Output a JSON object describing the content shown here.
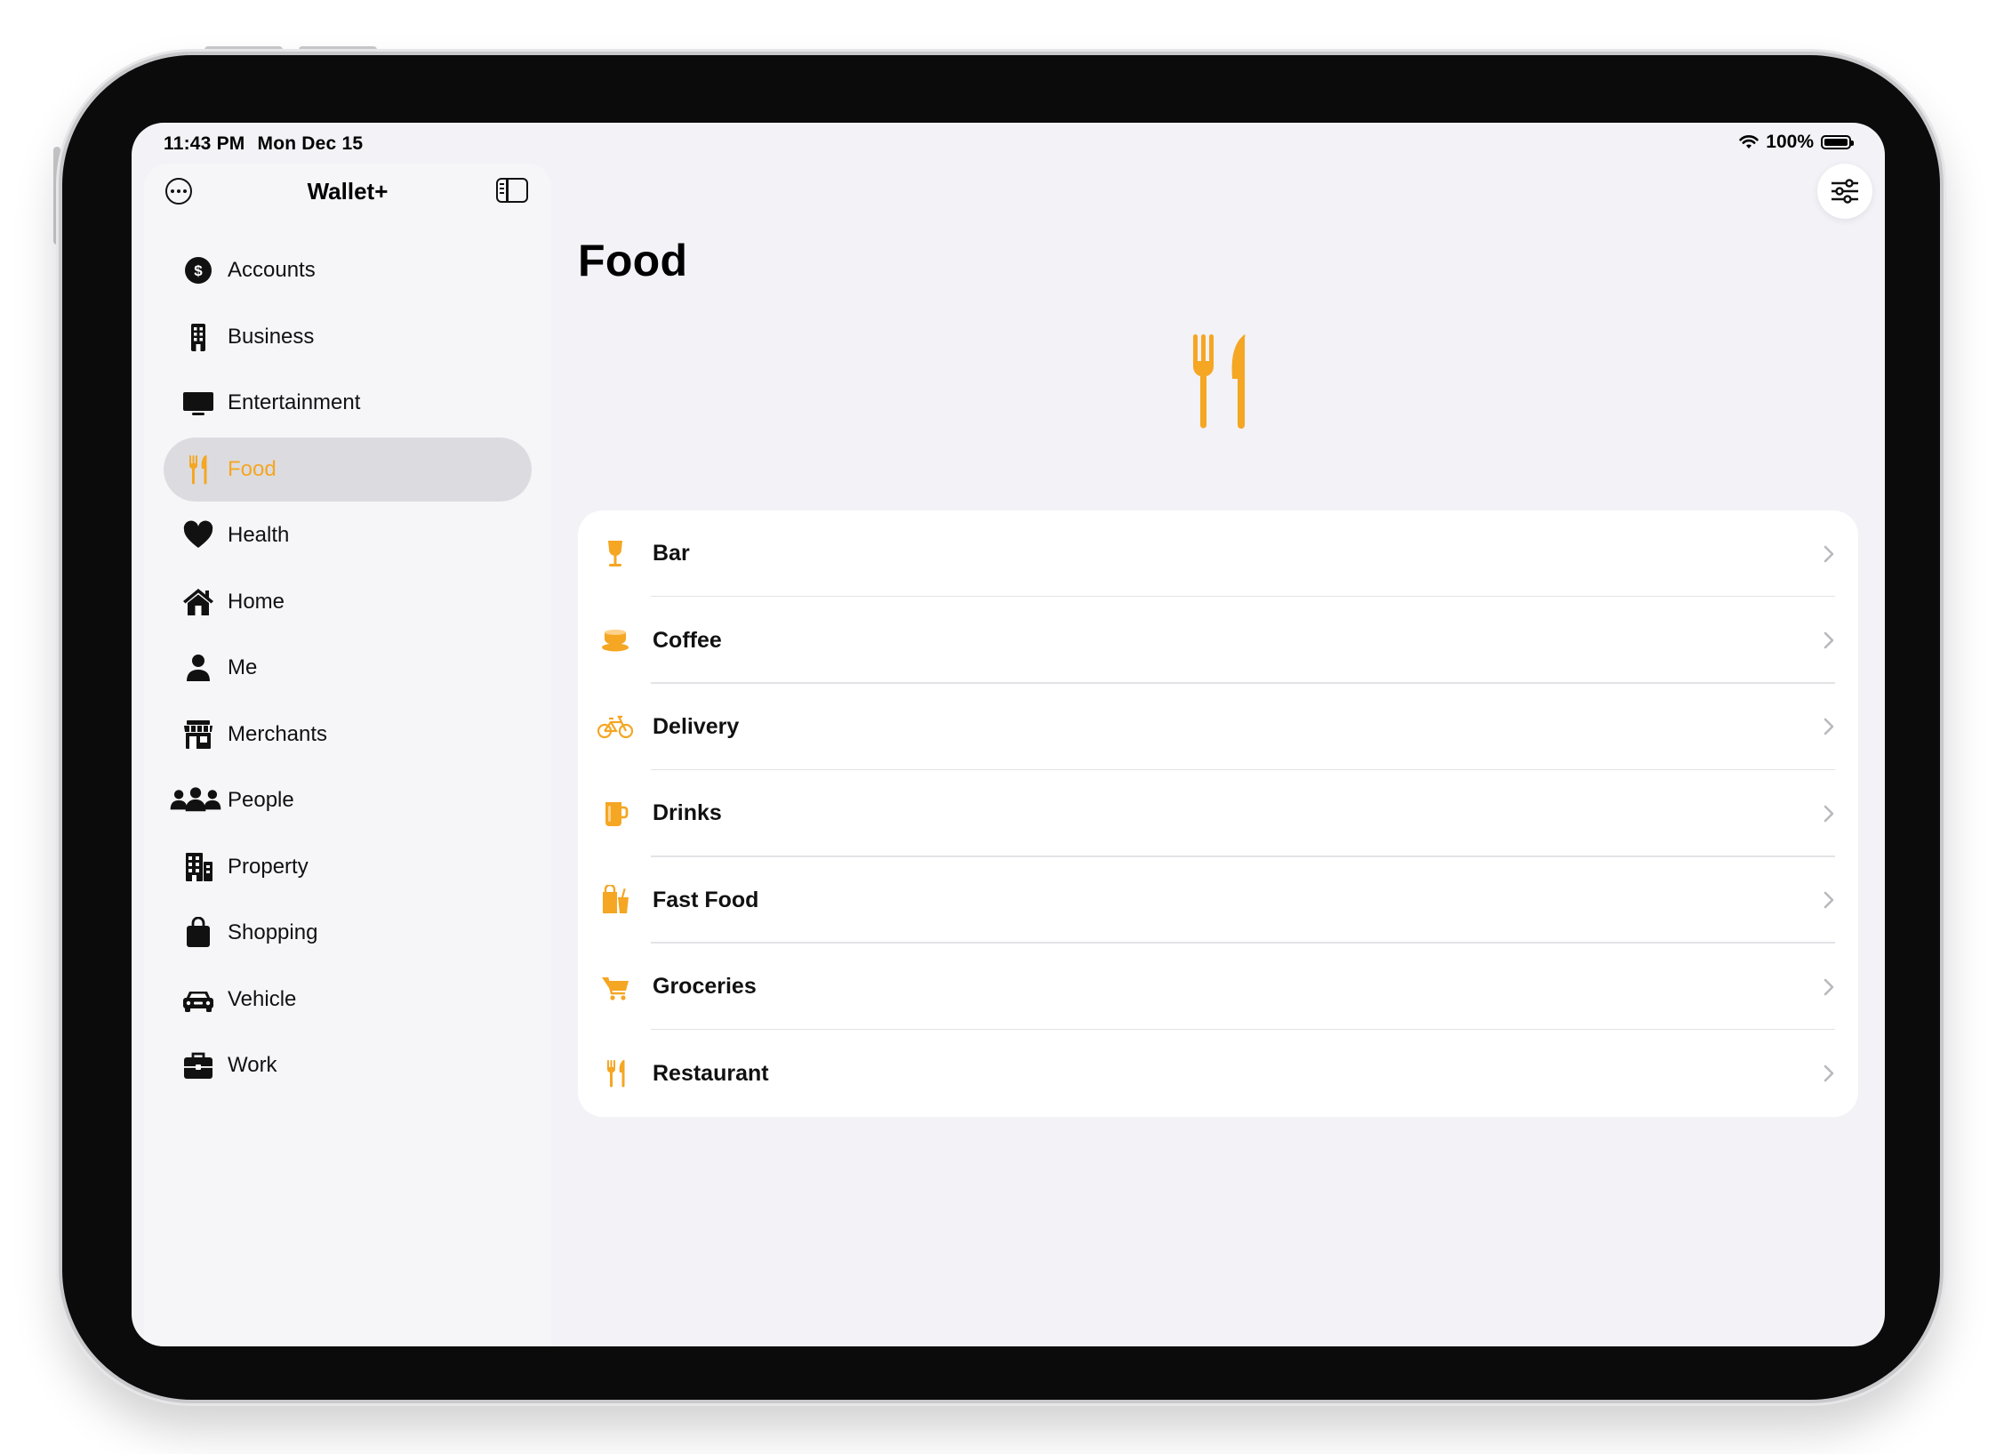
{
  "status_bar": {
    "time": "11:43 PM",
    "date": "Mon Dec 15",
    "battery": "100%"
  },
  "sidebar": {
    "title": "Wallet+",
    "items": [
      {
        "label": "Accounts",
        "icon": "dollar-circle-icon",
        "selected": false
      },
      {
        "label": "Business",
        "icon": "building-icon",
        "selected": false
      },
      {
        "label": "Entertainment",
        "icon": "tv-icon",
        "selected": false
      },
      {
        "label": "Food",
        "icon": "fork-knife-icon",
        "selected": true
      },
      {
        "label": "Health",
        "icon": "heart-icon",
        "selected": false
      },
      {
        "label": "Home",
        "icon": "house-icon",
        "selected": false
      },
      {
        "label": "Me",
        "icon": "person-icon",
        "selected": false
      },
      {
        "label": "Merchants",
        "icon": "storefront-icon",
        "selected": false
      },
      {
        "label": "People",
        "icon": "people-group-icon",
        "selected": false
      },
      {
        "label": "Property",
        "icon": "building-columns-icon",
        "selected": false
      },
      {
        "label": "Shopping",
        "icon": "bag-icon",
        "selected": false
      },
      {
        "label": "Vehicle",
        "icon": "car-icon",
        "selected": false
      },
      {
        "label": "Work",
        "icon": "briefcase-icon",
        "selected": false
      }
    ]
  },
  "main": {
    "title": "Food",
    "hero_icon": "fork-knife-icon",
    "subcategories": [
      {
        "label": "Bar",
        "icon": "wineglass-icon"
      },
      {
        "label": "Coffee",
        "icon": "coffee-cup-icon"
      },
      {
        "label": "Delivery",
        "icon": "bicycle-icon"
      },
      {
        "label": "Drinks",
        "icon": "mug-icon"
      },
      {
        "label": "Fast Food",
        "icon": "takeout-bag-icon"
      },
      {
        "label": "Groceries",
        "icon": "cart-icon"
      },
      {
        "label": "Restaurant",
        "icon": "fork-knife-icon"
      }
    ]
  },
  "colors": {
    "accent": "#f5a623",
    "background": "#f2f2f7",
    "sidebar": "#f6f6f9",
    "selected_row": "#dcdce0"
  }
}
